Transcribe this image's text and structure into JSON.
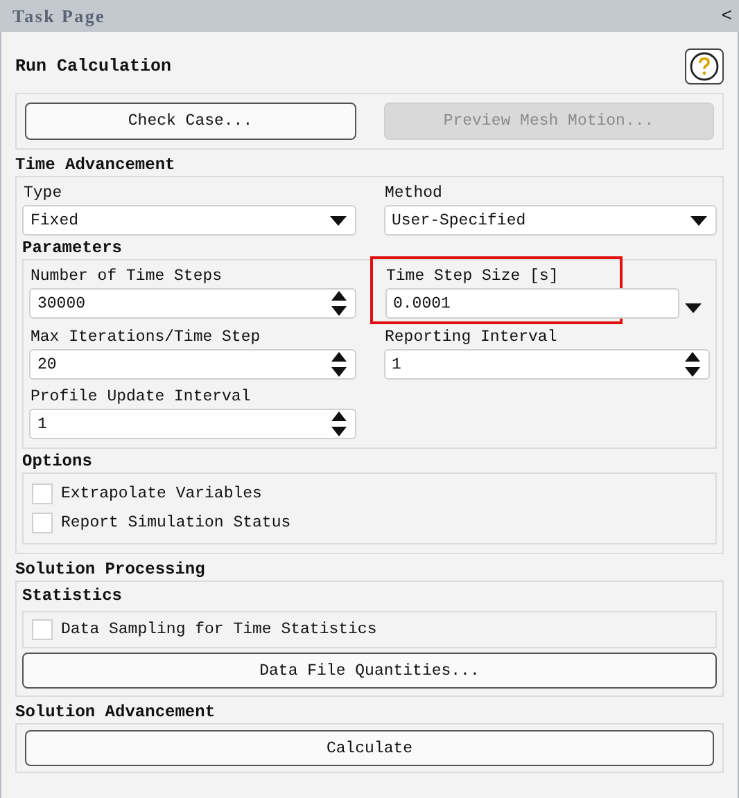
{
  "panel": {
    "title": "Task Page",
    "collapse_icon": "<"
  },
  "page_title": "Run Calculation",
  "top_buttons": [
    {
      "label": "Check Case...",
      "disabled": false
    },
    {
      "label": "Preview Mesh Motion...",
      "disabled": true
    }
  ],
  "time_advancement": {
    "title": "Time Advancement",
    "dropdowns": [
      {
        "label": "Type",
        "value": "Fixed"
      },
      {
        "label": "Method",
        "value": "User-Specified"
      }
    ],
    "parameters": {
      "title": "Parameters",
      "fields": [
        {
          "kind": "spinner",
          "label": "Number of Time Steps",
          "value": "30000",
          "highlighted": false
        },
        {
          "kind": "dropdown",
          "label": "Time Step Size [s]",
          "value": "0.0001",
          "highlighted": true
        },
        {
          "kind": "spinner",
          "label": "Max Iterations/Time Step",
          "value": "20",
          "highlighted": false
        },
        {
          "kind": "spinner",
          "label": "Reporting Interval",
          "value": "1",
          "highlighted": false
        },
        {
          "kind": "spinner",
          "label": "Profile Update Interval",
          "value": "1",
          "highlighted": false
        }
      ]
    },
    "options": {
      "title": "Options",
      "checkboxes": [
        {
          "label": "Extrapolate Variables",
          "checked": false
        },
        {
          "label": "Report Simulation Status",
          "checked": false
        }
      ]
    }
  },
  "solution_processing": {
    "title": "Solution Processing",
    "statistics": {
      "title": "Statistics",
      "checkboxes": [
        {
          "label": "Data Sampling for Time Statistics",
          "checked": false
        }
      ]
    },
    "button": "Data File Quantities..."
  },
  "solution_advancement": {
    "title": "Solution Advancement",
    "button": "Calculate"
  }
}
